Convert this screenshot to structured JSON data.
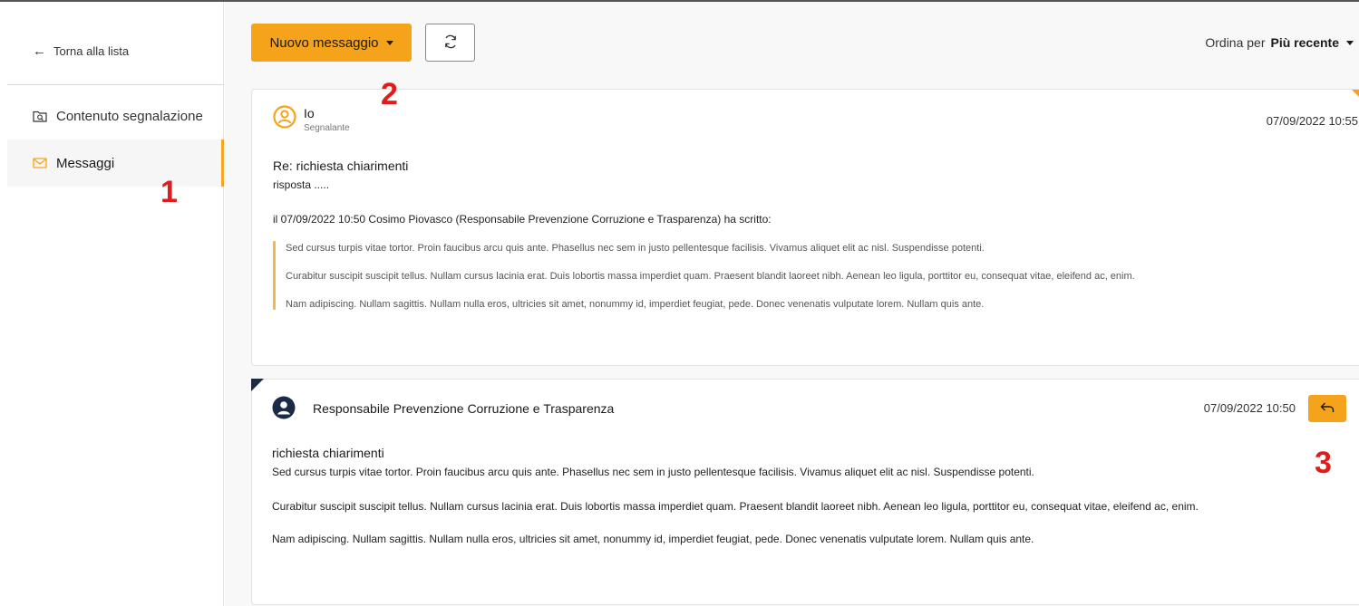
{
  "sidebar": {
    "back_label": "Torna alla lista",
    "items": [
      {
        "label": "Contenuto segnalazione",
        "icon": "folder-search-icon"
      },
      {
        "label": "Messaggi",
        "icon": "envelope-icon",
        "active": true
      }
    ]
  },
  "toolbar": {
    "new_message_label": "Nuovo messaggio",
    "refresh_icon": "refresh-icon",
    "sort_label": "Ordina per",
    "sort_value": "Più recente"
  },
  "annotations": {
    "one": "1",
    "two": "2",
    "three": "3"
  },
  "messages": [
    {
      "sender": "Io",
      "role": "Segnalante",
      "date": "07/09/2022 10:55",
      "subject": "Re: richiesta chiarimenti",
      "body": "risposta .....",
      "quote_header": "il 07/09/2022 10:50 Cosimo Piovasco (Responsabile Prevenzione Corruzione e Trasparenza) ha scritto:",
      "quote_lines": [
        "Sed cursus turpis vitae tortor. Proin faucibus arcu quis ante. Phasellus nec sem in justo pellentesque facilisis. Vivamus aliquet elit ac nisl. Suspendisse potenti.",
        "Curabitur suscipit suscipit tellus. Nullam cursus lacinia erat. Duis lobortis massa imperdiet quam. Praesent blandit laoreet nibh. Aenean leo ligula, porttitor eu, consequat vitae, eleifend ac, enim.",
        "Nam adipiscing. Nullam sagittis. Nullam nulla eros, ultricies sit amet, nonummy id, imperdiet feugiat, pede. Donec venenatis vulputate lorem. Nullam quis ante."
      ]
    },
    {
      "sender": "Responsabile Prevenzione Corruzione e Trasparenza",
      "date": "07/09/2022 10:50",
      "subject": "richiesta chiarimenti",
      "body_lines": [
        "Sed cursus turpis vitae tortor. Proin faucibus arcu quis ante. Phasellus nec sem in justo pellentesque facilisis. Vivamus aliquet elit ac nisl. Suspendisse potenti.",
        "Curabitur suscipit suscipit tellus. Nullam cursus lacinia erat. Duis lobortis massa imperdiet quam. Praesent blandit laoreet nibh. Aenean leo ligula, porttitor eu, consequat vitae, eleifend ac, enim.",
        "Nam adipiscing. Nullam sagittis. Nullam nulla eros, ultricies sit amet, nonummy id, imperdiet feugiat, pede. Donec venenatis vulputate lorem. Nullam quis ante."
      ],
      "reply_icon": "reply-icon"
    }
  ],
  "colors": {
    "accent": "#f5a31a",
    "annotation": "#e21c1c",
    "dark": "#1c2b45"
  }
}
